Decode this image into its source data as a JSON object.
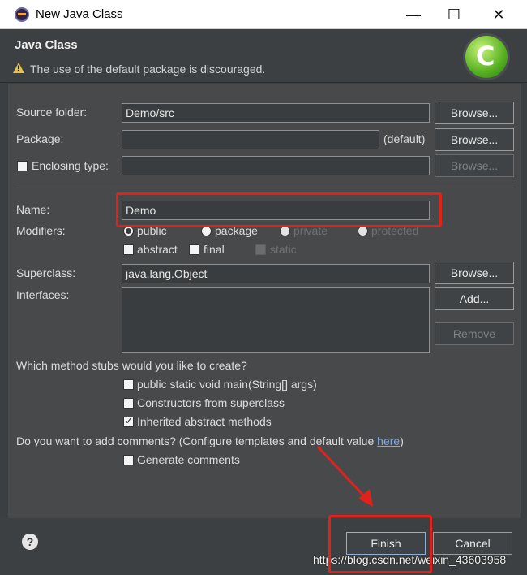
{
  "window": {
    "title": "New Java Class",
    "minimize_glyph": "—",
    "maximize_glyph": "☐",
    "close_glyph": "✕"
  },
  "header": {
    "title": "Java Class",
    "message": "The use of the default package is discouraged."
  },
  "form": {
    "source_folder": {
      "label": "Source folder:",
      "value": "Demo/src",
      "browse": "Browse..."
    },
    "package": {
      "label": "Package:",
      "value": "",
      "default_note": "(default)",
      "browse": "Browse..."
    },
    "enclosing_type": {
      "label": "Enclosing type:",
      "checked": false,
      "value": "",
      "browse": "Browse..."
    },
    "name": {
      "label": "Name:",
      "value": "Demo"
    },
    "modifiers": {
      "label": "Modifiers:",
      "public": "public",
      "package": "package",
      "private": "private",
      "protected": "protected",
      "abstract": "abstract",
      "final": "final",
      "static": "static",
      "selected": "public"
    },
    "superclass": {
      "label": "Superclass:",
      "value": "java.lang.Object",
      "browse": "Browse..."
    },
    "interfaces": {
      "label": "Interfaces:",
      "add": "Add...",
      "remove": "Remove"
    },
    "stubs": {
      "question": "Which method stubs would you like to create?",
      "main": "public static void main(String[] args)",
      "constructors": "Constructors from superclass",
      "inherited": "Inherited abstract methods",
      "main_checked": false,
      "constructors_checked": false,
      "inherited_checked": true
    },
    "comments": {
      "question": "Do you want to add comments? (Configure templates and default value ",
      "link": "here",
      "question_end": ")",
      "generate": "Generate comments",
      "generate_checked": false
    }
  },
  "footer": {
    "help": "?",
    "finish": "Finish",
    "cancel": "Cancel",
    "watermark": "https://blog.csdn.net/weixin_43603958"
  },
  "colors": {
    "annotation": "#e0221b",
    "background": "#47494b",
    "link": "#79a8e8"
  }
}
